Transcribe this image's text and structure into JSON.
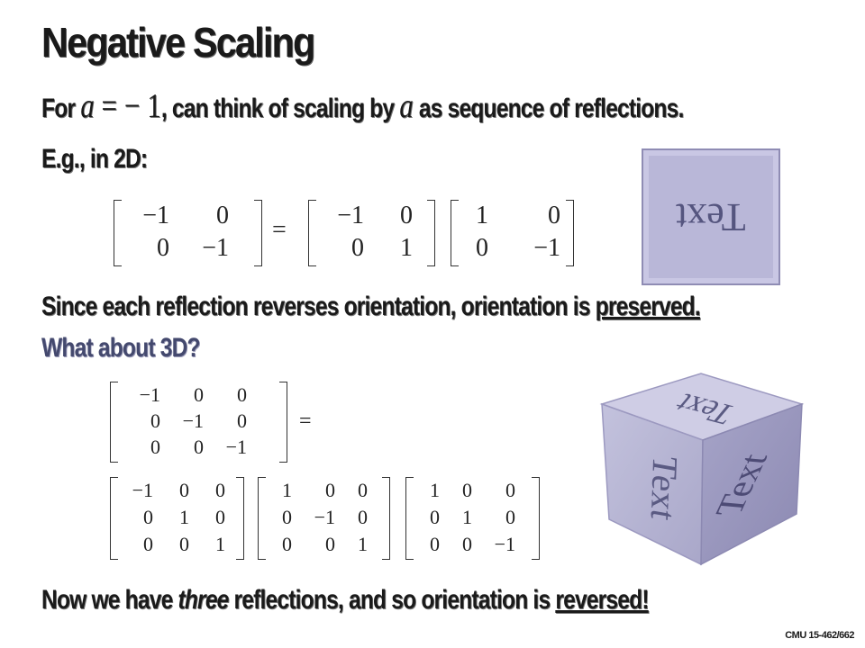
{
  "title": "Negative Scaling",
  "line1": {
    "pre": "For ",
    "a": "a",
    "eq": " = − 1",
    "mid": ", can think of scaling by ",
    "a2": "a",
    "post": " as sequence of reflections."
  },
  "line2": "E.g., in 2D:",
  "eq2d": {
    "lhs": [
      "−1",
      "0",
      "0",
      "−1"
    ],
    "m1": [
      "−1",
      "0",
      "0",
      "1"
    ],
    "m2": [
      "1",
      "0",
      "0",
      "−1"
    ],
    "equals": "="
  },
  "image_text": "Text",
  "line3": {
    "pre": "Since each reflection reverses orientation, orientation is ",
    "em": "preserved."
  },
  "line4": "What about 3D?",
  "eq3d": {
    "lhs": [
      "−1",
      "0",
      "0",
      "0",
      "−1",
      "0",
      "0",
      "0",
      "−1"
    ],
    "equals": "=",
    "m1": [
      "−1",
      "0",
      "0",
      "0",
      "1",
      "0",
      "0",
      "0",
      "1"
    ],
    "m2": [
      "1",
      "0",
      "0",
      "0",
      "−1",
      "0",
      "0",
      "0",
      "1"
    ],
    "m3": [
      "1",
      "0",
      "0",
      "0",
      "1",
      "0",
      "0",
      "0",
      "−1"
    ]
  },
  "cube_text": "Text",
  "line5": {
    "pre": "Now we have ",
    "em": "three",
    "post": " reflections, and so orientation is ",
    "u": "reversed!"
  },
  "footer": "CMU 15-462/662"
}
